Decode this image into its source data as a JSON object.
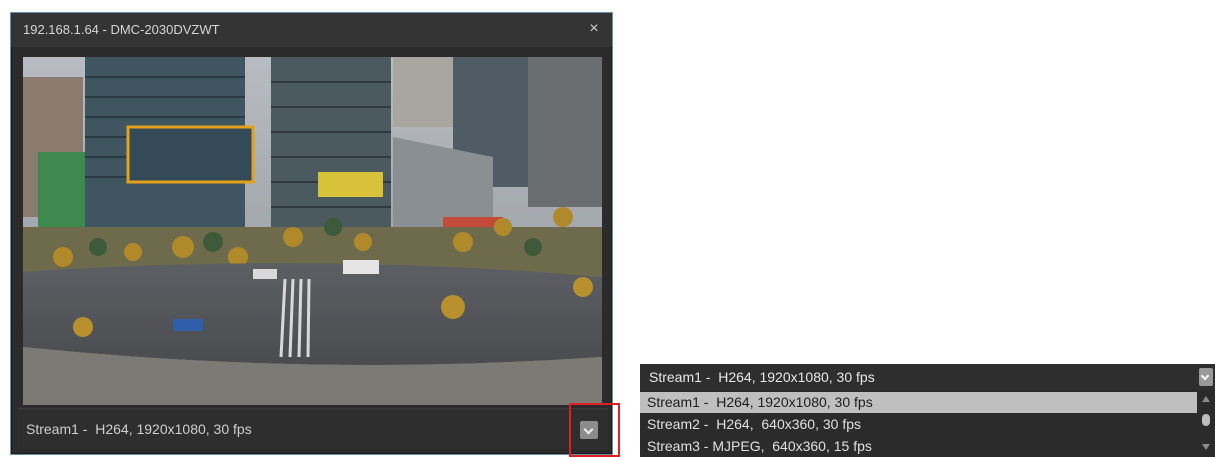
{
  "window": {
    "title": "192.168.1.64 - DMC-2030DVZWT",
    "close_icon": "×"
  },
  "video": {
    "description_icon": "camera-feed"
  },
  "stream_selector": {
    "current": "Stream1 -  H264, 1920x1080, 30 fps"
  },
  "dropdown": {
    "header": "Stream1 -  H264, 1920x1080, 30 fps",
    "options": [
      "Stream1 -  H264, 1920x1080, 30 fps",
      "Stream2 -  H264,  640x360, 30 fps",
      "Stream3 - MJPEG,  640x360, 15 fps"
    ],
    "selected_index": 0
  },
  "colors": {
    "highlight": "#e02020",
    "window_bg": "#2b2b2b",
    "selected_bg": "#bfbfbf"
  }
}
